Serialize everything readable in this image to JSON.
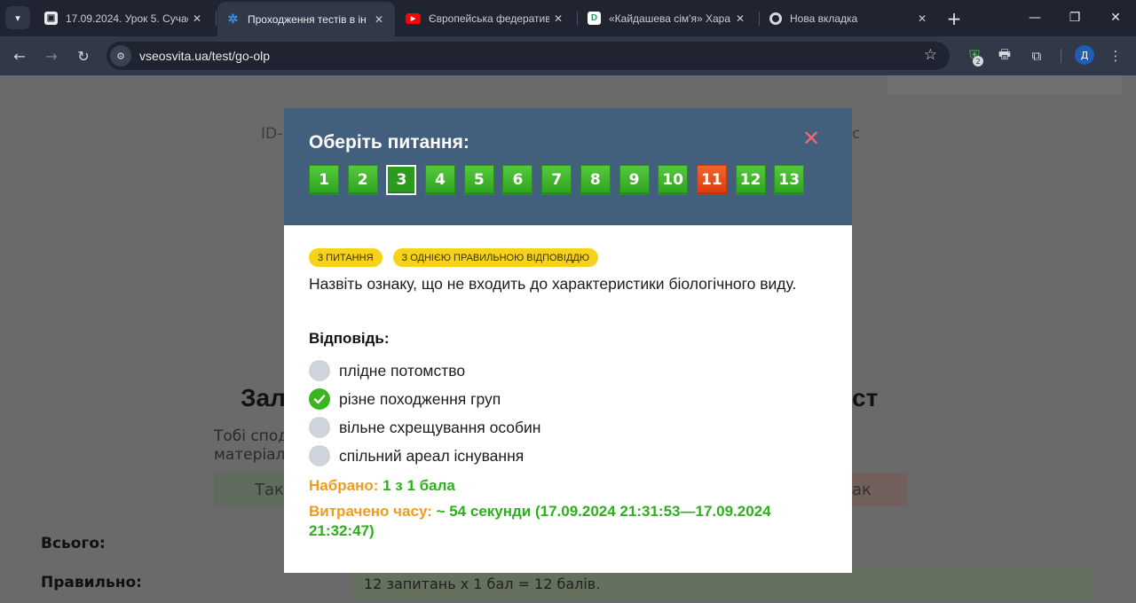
{
  "browser": {
    "tabs": [
      {
        "title": "17.09.2024. Урок 5. Сучас",
        "favicon": "classroom-icon",
        "color": "#e8eaed",
        "active": false
      },
      {
        "title": "Проходження тестів в ін",
        "favicon": "vseosvita-icon",
        "color": "#3b8ee8",
        "active": true
      },
      {
        "title": "Європейська федератив",
        "favicon": "youtube-icon",
        "color": "#ff0000",
        "active": false
      },
      {
        "title": "«Кайдашева сім'я» Хара",
        "favicon": "d-icon",
        "color": "#1aa05a",
        "active": false
      },
      {
        "title": "Нова вкладка",
        "favicon": "chrome-icon",
        "color": "#d4d7dd",
        "active": false
      }
    ],
    "url": "vseosvita.ua/test/go-olp",
    "ext_badge": "2",
    "profile_letter": "Д"
  },
  "background": {
    "id_prefix": "ID-",
    "id_suffix": "с",
    "heading_left": "Зал",
    "heading_right": "ст",
    "text_line1": "Тобі спод",
    "text_line2": "матеріал",
    "btn_left": "Так",
    "btn_right": "ак",
    "row_total": "Всього:",
    "row_correct": "Правильно:",
    "row_value": "12 запитань х 1 бал = 12 балів."
  },
  "modal": {
    "title": "Оберіть питання:",
    "questions": [
      {
        "label": "1",
        "state": "correct"
      },
      {
        "label": "2",
        "state": "correct"
      },
      {
        "label": "3",
        "state": "current"
      },
      {
        "label": "4",
        "state": "correct"
      },
      {
        "label": "5",
        "state": "correct"
      },
      {
        "label": "6",
        "state": "correct"
      },
      {
        "label": "7",
        "state": "correct"
      },
      {
        "label": "8",
        "state": "correct"
      },
      {
        "label": "9",
        "state": "correct"
      },
      {
        "label": "10",
        "state": "correct"
      },
      {
        "label": "11",
        "state": "wrong"
      },
      {
        "label": "12",
        "state": "correct"
      },
      {
        "label": "13",
        "state": "correct"
      }
    ],
    "badge_number": "3 ПИТАННЯ",
    "badge_type": "З ОДНІЄЮ ПРАВИЛЬНОЮ ВІДПОВІДДЮ",
    "question_text": "Назвіть ознаку, що не входить до характеристики біологічного виду.",
    "answer_label": "Відповідь:",
    "options": [
      {
        "text": "плідне потомство",
        "checked": false
      },
      {
        "text": "різне походження груп",
        "checked": true
      },
      {
        "text": "вільне схрещування особин",
        "checked": false
      },
      {
        "text": "спільний ареал існування",
        "checked": false
      }
    ],
    "score_label": "Набрано:",
    "score_value": "1 з 1 бала",
    "time_label": "Витрачено часу:",
    "time_value": "~ 54 секунди (17.09.2024 21:31:53—17.09.2024 21:32:47)"
  }
}
